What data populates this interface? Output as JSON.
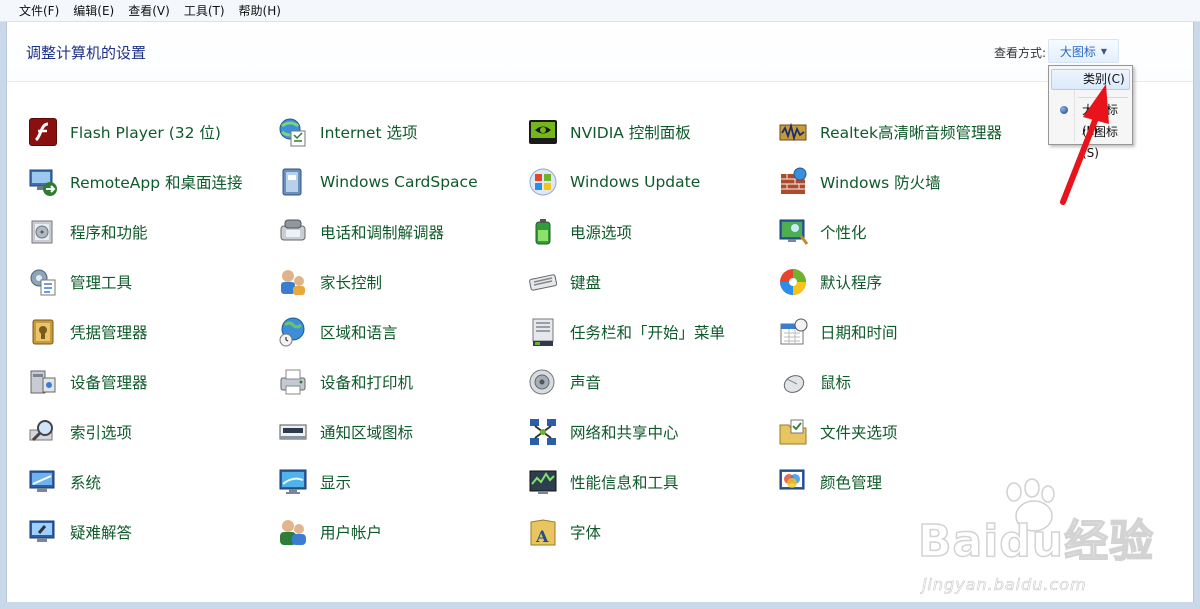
{
  "menu": [
    "文件(F)",
    "编辑(E)",
    "查看(V)",
    "工具(T)",
    "帮助(H)"
  ],
  "header": {
    "title": "调整计算机的设置",
    "view_label": "查看方式:",
    "view_value": "大图标"
  },
  "view_menu": {
    "items": [
      "类别(C)",
      "大图标(L)",
      "小图标(S)"
    ],
    "selected": "大图标(L)",
    "highlighted": "类别(C)"
  },
  "columns": [
    [
      "Flash Player (32 位)",
      "RemoteApp 和桌面连接",
      "程序和功能",
      "管理工具",
      "凭据管理器",
      "设备管理器",
      "索引选项",
      "系统",
      "疑难解答"
    ],
    [
      "Internet 选项",
      "Windows CardSpace",
      "电话和调制解调器",
      "家长控制",
      "区域和语言",
      "设备和打印机",
      "通知区域图标",
      "显示",
      "用户帐户"
    ],
    [
      "NVIDIA 控制面板",
      "Windows Update",
      "电源选项",
      "键盘",
      "任务栏和「开始」菜单",
      "声音",
      "网络和共享中心",
      "性能信息和工具",
      "字体"
    ],
    [
      "Realtek高清晰音频管理器",
      "Windows 防火墙",
      "个性化",
      "默认程序",
      "日期和时间",
      "鼠标",
      "文件夹选项",
      "颜色管理"
    ]
  ],
  "icons": [
    [
      "flash-icon",
      "remote-desktop-icon",
      "programs-icon",
      "admin-tools-icon",
      "credential-icon",
      "device-manager-icon",
      "index-search-icon",
      "system-icon",
      "troubleshoot-icon"
    ],
    [
      "internet-options-icon",
      "cardspace-icon",
      "phone-modem-icon",
      "parental-control-icon",
      "region-globe-icon",
      "printer-icon",
      "notification-icon",
      "display-icon",
      "user-accounts-icon"
    ],
    [
      "nvidia-icon",
      "windows-update-icon",
      "power-icon",
      "keyboard-icon",
      "taskbar-icon",
      "sound-icon",
      "network-icon",
      "performance-icon",
      "fonts-icon"
    ],
    [
      "realtek-audio-icon",
      "firewall-icon",
      "personalize-icon",
      "default-programs-icon",
      "date-time-icon",
      "mouse-icon",
      "folder-options-icon",
      "color-management-icon"
    ]
  ],
  "colors": {
    "link": "#0f5a2a",
    "title": "#1e3287",
    "annotation_arrow": "#e8141b"
  },
  "watermark": {
    "brand": "Baidu",
    "brand_suffix": "经验",
    "url": "jingyan.baidu.com"
  }
}
